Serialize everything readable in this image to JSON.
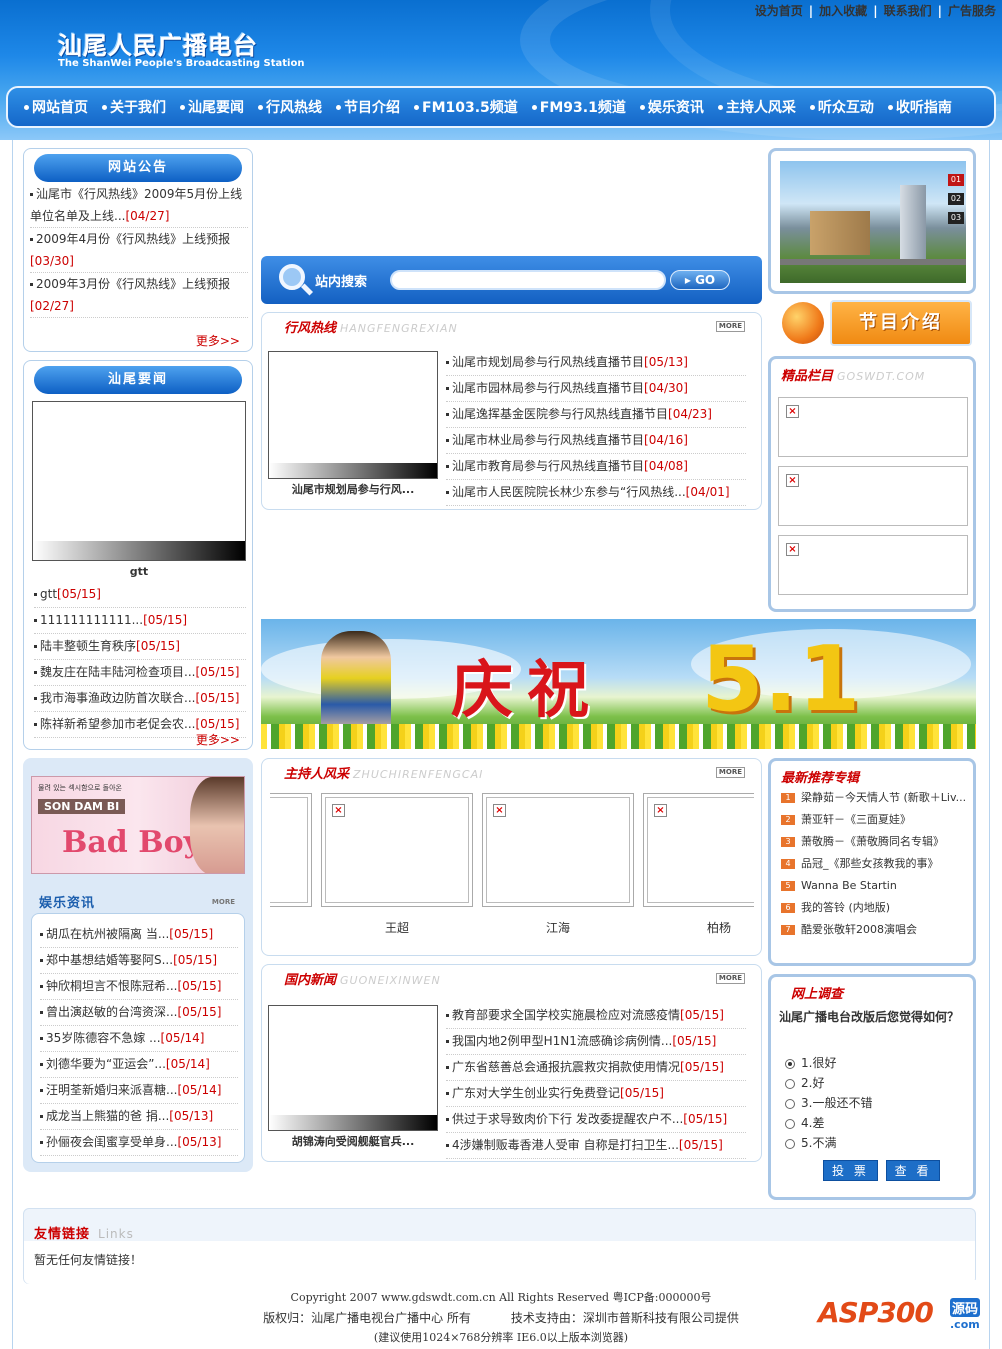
{
  "header": {
    "top_links": [
      "设为首页",
      "加入收藏",
      "联系我们",
      "广告服务"
    ],
    "logo_cn": "汕尾人民广播电台",
    "logo_en": "The ShanWei People's Broadcasting Station"
  },
  "nav": [
    "网站首页",
    "关于我们",
    "汕尾要闻",
    "行风热线",
    "节目介绍",
    "FM103.5频道",
    "FM93.1频道",
    "娱乐资讯",
    "主持人风采",
    "听众互动",
    "收听指南"
  ],
  "notice": {
    "title": "网站公告",
    "items": [
      {
        "text": "汕尾市《行风热线》2009年5月份上线单位名单及上线...",
        "date": "[04/27]"
      },
      {
        "text": "2009年4月份《行风热线》上线预报",
        "date": "[03/30]"
      },
      {
        "text": "2009年3月份《行风热线》上线预报",
        "date": "[02/27]"
      }
    ],
    "more": "更多>>"
  },
  "local_news": {
    "title": "汕尾要闻",
    "image_caption": "gtt",
    "items": [
      {
        "text": "gtt",
        "date": "[05/15]"
      },
      {
        "text": "111111111111...",
        "date": "[05/15]"
      },
      {
        "text": "陆丰整顿生育秩序",
        "date": "[05/15]"
      },
      {
        "text": "魏友庄在陆丰陆河检查项目...",
        "date": "[05/15]"
      },
      {
        "text": "我市海事渔政边防首次联合...",
        "date": "[05/15]"
      },
      {
        "text": "陈祥新希望参加市老促会农...",
        "date": "[05/15]"
      }
    ],
    "more": "更多>>"
  },
  "ent": {
    "banner_text_small": "물려 있는 섹시함으로 돌아온",
    "banner_artist": "SON DAM BI",
    "banner_title": "Bad Boy",
    "title": "娱乐资讯",
    "more": "MORE",
    "items": [
      {
        "text": "胡瓜在杭州被隔离 当...",
        "date": "[05/15]"
      },
      {
        "text": "郑中基想结婚等娶阿S...",
        "date": "[05/15]"
      },
      {
        "text": "钟欣桐坦言不恨陈冠希...",
        "date": "[05/15]"
      },
      {
        "text": "曾出演赵敏的台湾资深...",
        "date": "[05/15]"
      },
      {
        "text": "35岁陈德容不急嫁 ...",
        "date": "[05/14]"
      },
      {
        "text": "刘德华要为“亚运会”...",
        "date": "[05/14]"
      },
      {
        "text": "汪明荃新婚归来派喜糖...",
        "date": "[05/14]"
      },
      {
        "text": "成龙当上熊猫的爸 捐...",
        "date": "[05/13]"
      },
      {
        "text": "孙俪夜会闺蜜享受单身...",
        "date": "[05/13]"
      }
    ]
  },
  "search": {
    "label": "站内搜索",
    "button": "GO",
    "placeholder": ""
  },
  "hotline": {
    "title": "行风热线",
    "title_py": "HANGFENGREXIAN",
    "more": "MORE",
    "image_caption": "汕尾市规划局参与行风...",
    "items": [
      {
        "text": "汕尾市规划局参与行风热线直播节目",
        "date": "[05/13]"
      },
      {
        "text": "汕尾市园林局参与行风热线直播节目",
        "date": "[04/30]"
      },
      {
        "text": "汕尾逸挥基金医院参与行风热线直播节目",
        "date": "[04/23]"
      },
      {
        "text": "汕尾市林业局参与行风热线直播节目",
        "date": "[04/16]"
      },
      {
        "text": "汕尾市教育局参与行风热线直播节目",
        "date": "[04/08]"
      },
      {
        "text": "汕尾市人民医院院长林少东参与“行风热线...",
        "date": "[04/01]"
      }
    ]
  },
  "banner51": {
    "text": "庆祝",
    "num": "5.1"
  },
  "hosts": {
    "title": "主持人风采",
    "title_py": "ZHUCHIRENFENGCAI",
    "more": "MORE",
    "names": [
      "王超",
      "江海",
      "柏杨"
    ]
  },
  "domestic": {
    "title": "国内新闻",
    "title_py": "GUONEIXINWEN",
    "more": "MORE",
    "image_caption": "胡锦涛向受阅舰艇官兵...",
    "items": [
      {
        "text": "教育部要求全国学校实施晨检应对流感疫情",
        "date": "[05/15]"
      },
      {
        "text": "我国内地2例甲型H1N1流感确诊病例情...",
        "date": "[05/15]"
      },
      {
        "text": "广东省慈善总会通报抗震救灾捐款使用情况",
        "date": "[05/15]"
      },
      {
        "text": "广东对大学生创业实行免费登记",
        "date": "[05/15]"
      },
      {
        "text": "供过于求导致肉价下行 发改委提醒农户不...",
        "date": "[05/15]"
      },
      {
        "text": "4涉嫌制贩毒香港人受审 自称是打扫卫生...",
        "date": "[05/15]"
      }
    ]
  },
  "slider_nums": [
    "01",
    "02",
    "03"
  ],
  "program_btn": "节目介绍",
  "featured": {
    "title": "精品栏目",
    "title_py": "GOSWDT.COM"
  },
  "albums": {
    "title": "最新推荐专辑",
    "items": [
      {
        "num": "1",
        "text": "梁静茹－今天情人节 (新歌＋Liv..."
      },
      {
        "num": "2",
        "text": "萧亚轩－《三面夏娃》"
      },
      {
        "num": "3",
        "text": "萧敬腾－《萧敬腾同名专辑》"
      },
      {
        "num": "4",
        "text": "品冠_《那些女孩教我的事》"
      },
      {
        "num": "5",
        "text": "Wanna Be Startin"
      },
      {
        "num": "6",
        "text": "我的答铃 (内地版)"
      },
      {
        "num": "7",
        "text": "酷爱张敬轩2008演唱会"
      }
    ]
  },
  "survey": {
    "title": "网上调查",
    "question": "汕尾广播电台改版后您觉得如何？",
    "options": [
      "1.很好",
      "2.好",
      "3.一般还不错",
      "4.差",
      "5.不满"
    ],
    "vote": "投 票",
    "view": "查 看"
  },
  "links": {
    "title": "友情链接",
    "title_en": "Links",
    "text": "暂无任何友情链接！"
  },
  "footer": {
    "line1": "Copyright 2007 www.gdswdt.com.cn All Rights Reserved 粤ICP备:000000号",
    "line2a": "版权归：汕尾广播电视台广播中心 所有",
    "line2b": "技术支持由：深圳市普斯科技有限公司提供",
    "line3": "(建议使用1024×768分辨率 IE6.0以上版本浏览器)",
    "badge": "ASP300",
    "badge_cn": "源码",
    "badge_com": ".com"
  }
}
